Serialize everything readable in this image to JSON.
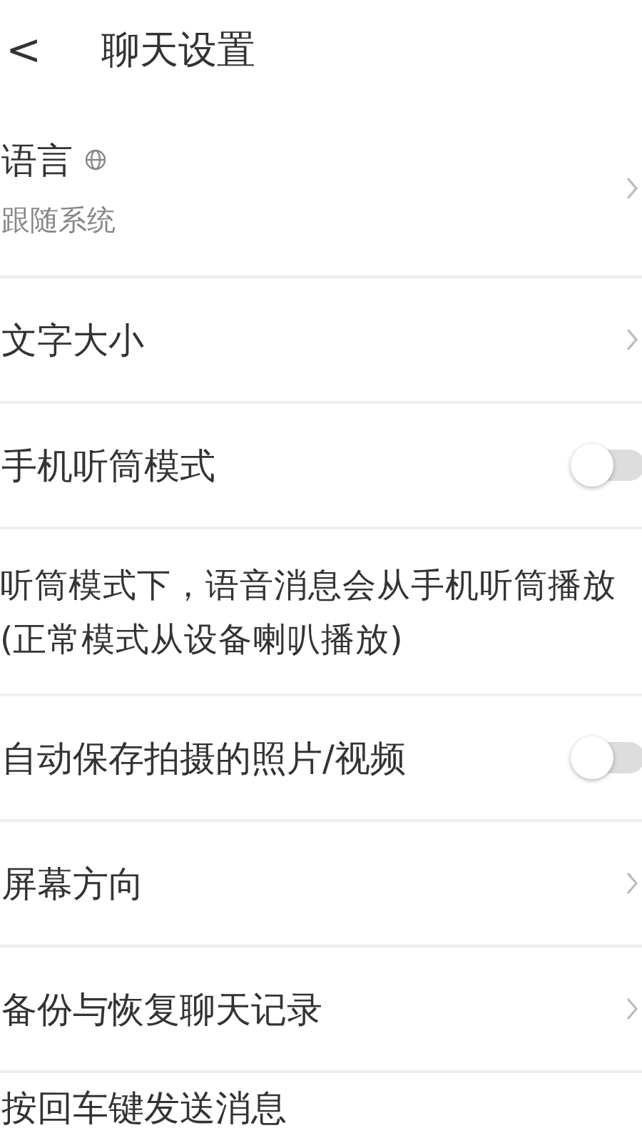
{
  "header": {
    "back": "<",
    "title": "聊天设置"
  },
  "items": [
    {
      "kind": "nav",
      "label": "语言",
      "globe": true,
      "sublabel": "跟随系统"
    },
    {
      "kind": "nav",
      "label": "文字大小"
    },
    {
      "kind": "toggle",
      "label": "手机听筒模式",
      "on": false
    },
    {
      "kind": "note",
      "lines": [
        "听筒模式下，语音消息会从手机听筒播放",
        "(正常模式从设备喇叭播放)"
      ]
    },
    {
      "kind": "toggle",
      "label": "自动保存拍摄的照片/视频",
      "on": false
    },
    {
      "kind": "nav",
      "label": "屏幕方向"
    },
    {
      "kind": "nav",
      "label": "备份与恢复聊天记录"
    },
    {
      "kind": "plain",
      "label": "按回车键发送消息"
    }
  ]
}
